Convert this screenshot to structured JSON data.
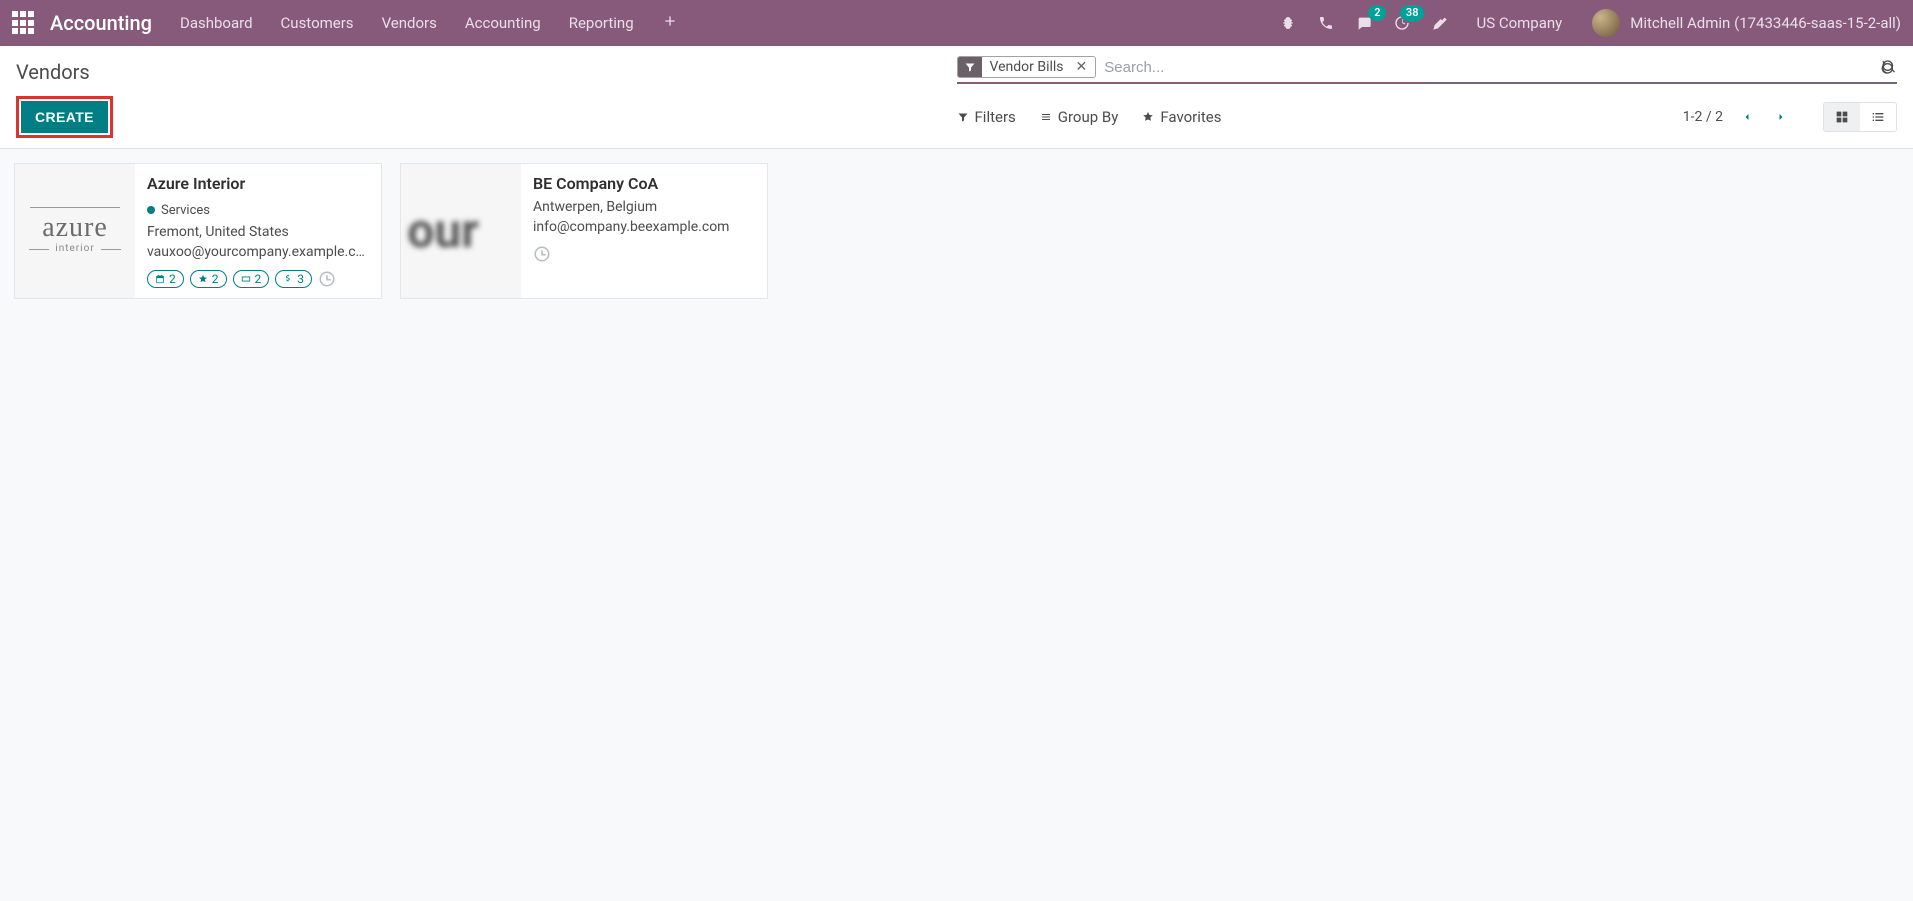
{
  "brand": "Accounting",
  "nav": {
    "dashboard": "Dashboard",
    "customers": "Customers",
    "vendors": "Vendors",
    "accounting": "Accounting",
    "reporting": "Reporting"
  },
  "tray": {
    "chat_badge": "2",
    "activity_badge": "38",
    "company": "US Company",
    "user": "Mitchell Admin (17433446-saas-15-2-all)"
  },
  "breadcrumb": "Vendors",
  "search": {
    "filter_tag": "Vendor Bills",
    "placeholder": "Search...",
    "filters_label": "Filters",
    "groupby_label": "Group By",
    "favorites_label": "Favorites"
  },
  "toolbar": {
    "create_label": "CREATE",
    "pager": "1-2 / 2"
  },
  "vendors": [
    {
      "name": "Azure Interior",
      "tag": "Services",
      "location": "Fremont, United States",
      "email": "vauxoo@yourcompany.example.c…",
      "pill_cal": "2",
      "pill_star": "2",
      "pill_card": "2",
      "pill_money": "3"
    },
    {
      "name": "BE Company CoA",
      "location": "Antwerpen, Belgium",
      "email": "info@company.beexample.com"
    }
  ]
}
